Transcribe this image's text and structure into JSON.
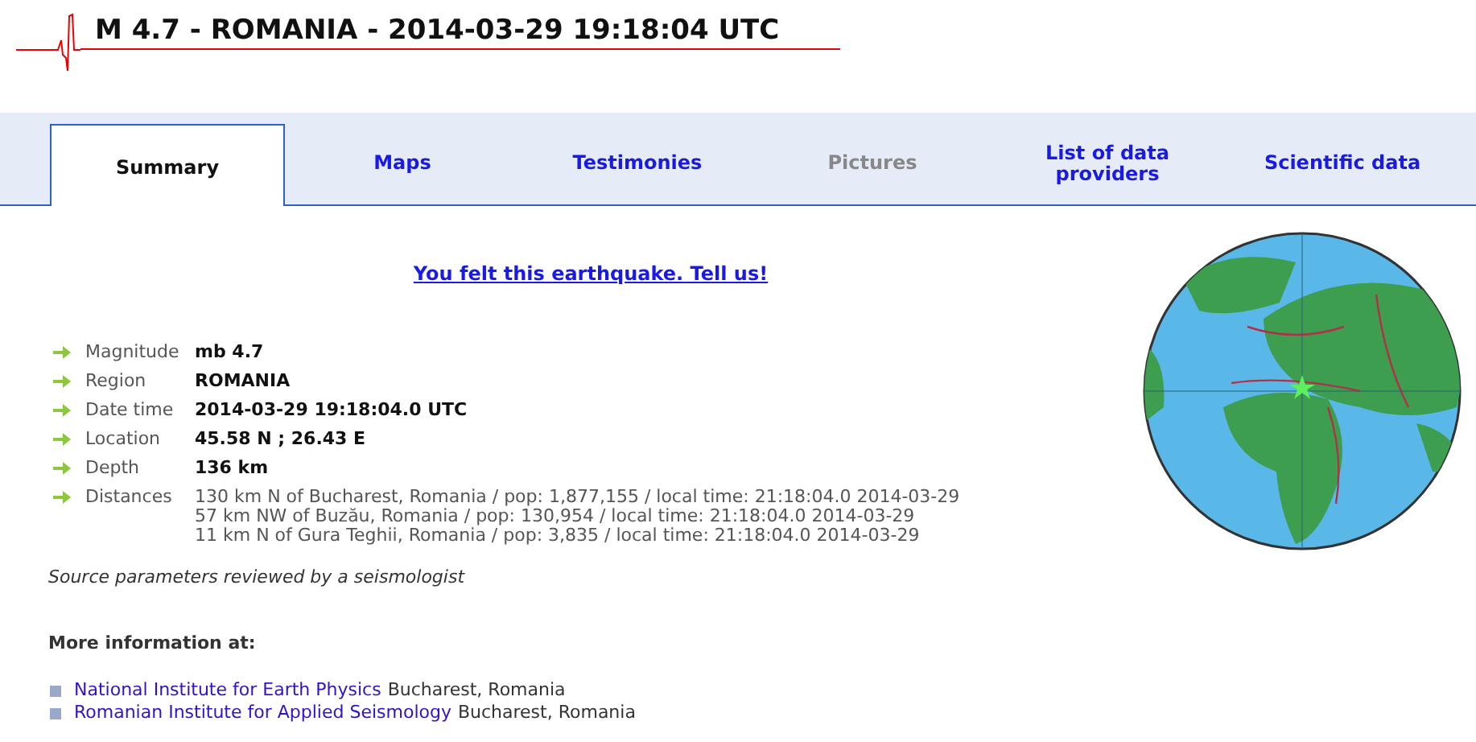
{
  "header": {
    "title": "M 4.7 - ROMANIA - 2014-03-29 19:18:04 UTC"
  },
  "tabs": [
    {
      "label": "Summary",
      "selected": true,
      "disabled": false
    },
    {
      "label": "Maps",
      "selected": false,
      "disabled": false
    },
    {
      "label": "Testimonies",
      "selected": false,
      "disabled": false
    },
    {
      "label": "Pictures",
      "selected": false,
      "disabled": true
    },
    {
      "label": "List of data providers",
      "selected": false,
      "disabled": false
    },
    {
      "label": "Scientific data",
      "selected": false,
      "disabled": false
    }
  ],
  "felt_link": "You felt this earthquake. Tell us!",
  "details": [
    {
      "label": "Magnitude",
      "values": [
        "mb 4.7"
      ],
      "bold": true
    },
    {
      "label": "Region",
      "values": [
        "ROMANIA"
      ],
      "bold": true
    },
    {
      "label": "Date time",
      "values": [
        "2014-03-29 19:18:04.0 UTC"
      ],
      "bold": true
    },
    {
      "label": "Location",
      "values": [
        "45.58 N ; 26.43 E"
      ],
      "bold": true
    },
    {
      "label": "Depth",
      "values": [
        "136 km"
      ],
      "bold": true
    },
    {
      "label": "Distances",
      "values": [
        "130 km N of Bucharest, Romania / pop: 1,877,155 / local time: 21:18:04.0 2014-03-29",
        "57 km NW of Buzău, Romania / pop: 130,954 / local time: 21:18:04.0 2014-03-29",
        "11 km N of Gura Teghii, Romania / pop: 3,835 / local time: 21:18:04.0 2014-03-29"
      ],
      "bold": false
    }
  ],
  "source_note": "Source parameters reviewed by a seismologist",
  "more_info": {
    "heading": "More information at:",
    "links": [
      {
        "link": "National Institute for Earth Physics",
        "place": "Bucharest, Romania"
      },
      {
        "link": "Romanian Institute for Applied Seismology",
        "place": "Bucharest, Romania"
      }
    ]
  }
}
